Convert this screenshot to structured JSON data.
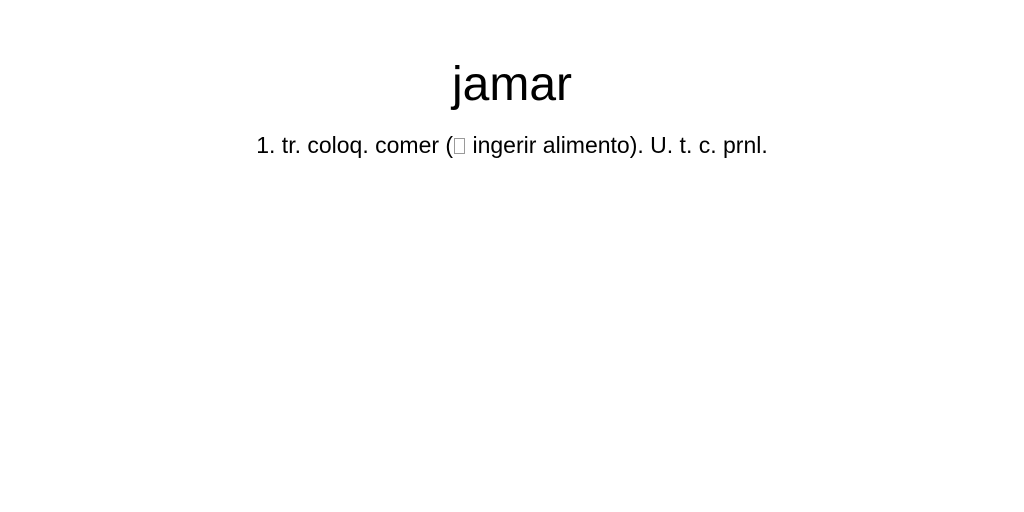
{
  "entry": {
    "headword": "jamar",
    "definition": {
      "before_symbol": "1. tr. coloq. comer (",
      "symbol_icon": "missing-glyph-box",
      "after_symbol": " ingerir alimento). U. t. c. prnl."
    }
  }
}
